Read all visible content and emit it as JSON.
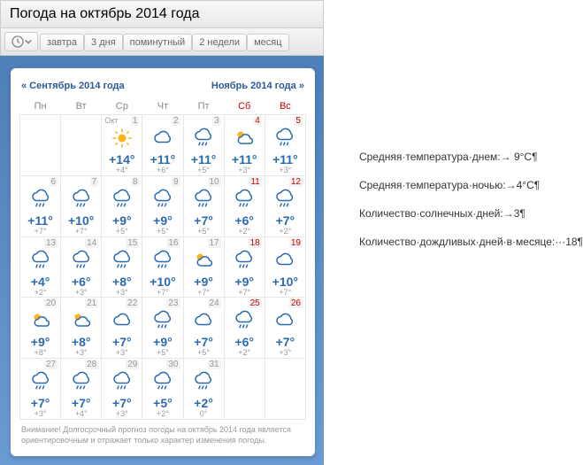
{
  "header": {
    "title": "Погода на октябрь 2014 года"
  },
  "toolbar": {
    "tabs": [
      "завтра",
      "3 дня",
      "поминутный",
      "2 недели",
      "месяц"
    ]
  },
  "nav": {
    "prev": "« Сентябрь 2014 года",
    "next": "Ноябрь 2014 года »"
  },
  "weekdays": [
    "Пн",
    "Вт",
    "Ср",
    "Чт",
    "Пт",
    "Сб",
    "Вс"
  ],
  "month_label": "Окт",
  "days": [
    {
      "n": 1,
      "wknd": false,
      "icon": "sun",
      "hi": "+14°",
      "lo": "+4°",
      "first": true
    },
    {
      "n": 2,
      "wknd": false,
      "icon": "cloud",
      "hi": "+11°",
      "lo": "+6°"
    },
    {
      "n": 3,
      "wknd": false,
      "icon": "rain",
      "hi": "+11°",
      "lo": "+5°"
    },
    {
      "n": 4,
      "wknd": true,
      "icon": "partly",
      "hi": "+11°",
      "lo": "+3°"
    },
    {
      "n": 5,
      "wknd": true,
      "icon": "rain",
      "hi": "+11°",
      "lo": "+3°"
    },
    {
      "n": 6,
      "wknd": false,
      "icon": "rain",
      "hi": "+11°",
      "lo": "+7°"
    },
    {
      "n": 7,
      "wknd": false,
      "icon": "rain",
      "hi": "+10°",
      "lo": "+7°"
    },
    {
      "n": 8,
      "wknd": false,
      "icon": "rain",
      "hi": "+9°",
      "lo": "+5°"
    },
    {
      "n": 9,
      "wknd": false,
      "icon": "rain",
      "hi": "+9°",
      "lo": "+5°"
    },
    {
      "n": 10,
      "wknd": false,
      "icon": "rain",
      "hi": "+7°",
      "lo": "+5°"
    },
    {
      "n": 11,
      "wknd": true,
      "icon": "rain",
      "hi": "+6°",
      "lo": "+2°"
    },
    {
      "n": 12,
      "wknd": true,
      "icon": "rain",
      "hi": "+7°",
      "lo": "+2°"
    },
    {
      "n": 13,
      "wknd": false,
      "icon": "rain",
      "hi": "+4°",
      "lo": "+2°"
    },
    {
      "n": 14,
      "wknd": false,
      "icon": "rain",
      "hi": "+6°",
      "lo": "+3°"
    },
    {
      "n": 15,
      "wknd": false,
      "icon": "rain",
      "hi": "+8°",
      "lo": "+3°"
    },
    {
      "n": 16,
      "wknd": false,
      "icon": "rain",
      "hi": "+10°",
      "lo": "+7°"
    },
    {
      "n": 17,
      "wknd": false,
      "icon": "partly",
      "hi": "+9°",
      "lo": "+7°"
    },
    {
      "n": 18,
      "wknd": true,
      "icon": "rain",
      "hi": "+9°",
      "lo": "+7°"
    },
    {
      "n": 19,
      "wknd": true,
      "icon": "cloud",
      "hi": "+10°",
      "lo": "+7°"
    },
    {
      "n": 20,
      "wknd": false,
      "icon": "partly",
      "hi": "+9°",
      "lo": "+8°"
    },
    {
      "n": 21,
      "wknd": false,
      "icon": "partly",
      "hi": "+8°",
      "lo": "+3°"
    },
    {
      "n": 22,
      "wknd": false,
      "icon": "cloud",
      "hi": "+7°",
      "lo": "+3°"
    },
    {
      "n": 23,
      "wknd": false,
      "icon": "rain",
      "hi": "+9°",
      "lo": "+5°"
    },
    {
      "n": 24,
      "wknd": false,
      "icon": "cloud",
      "hi": "+7°",
      "lo": "+5°"
    },
    {
      "n": 25,
      "wknd": true,
      "icon": "rain",
      "hi": "+6°",
      "lo": "+2°"
    },
    {
      "n": 26,
      "wknd": true,
      "icon": "cloud",
      "hi": "+7°",
      "lo": "+3°"
    },
    {
      "n": 27,
      "wknd": false,
      "icon": "rain",
      "hi": "+7°",
      "lo": "+3°"
    },
    {
      "n": 28,
      "wknd": false,
      "icon": "rain",
      "hi": "+7°",
      "lo": "+4°"
    },
    {
      "n": 29,
      "wknd": false,
      "icon": "rain",
      "hi": "+7°",
      "lo": "+3°"
    },
    {
      "n": 30,
      "wknd": false,
      "icon": "rain",
      "hi": "+5°",
      "lo": "+2°"
    },
    {
      "n": 31,
      "wknd": false,
      "icon": "rain",
      "hi": "+2°",
      "lo": "0°"
    }
  ],
  "footnote": "Внимание! Долгосрочный прогноз погоды на октябрь 2014 года является ориентировочным и отражает только характер изменения погоды.",
  "stats": [
    "Средняя·температура·днем:→ 9°С¶",
    "Средняя·температура·ночью:→4°С¶",
    "Количество·солнечных·дней:→3¶",
    "Количество·дождливых·дней·в·месяце:···18¶"
  ]
}
